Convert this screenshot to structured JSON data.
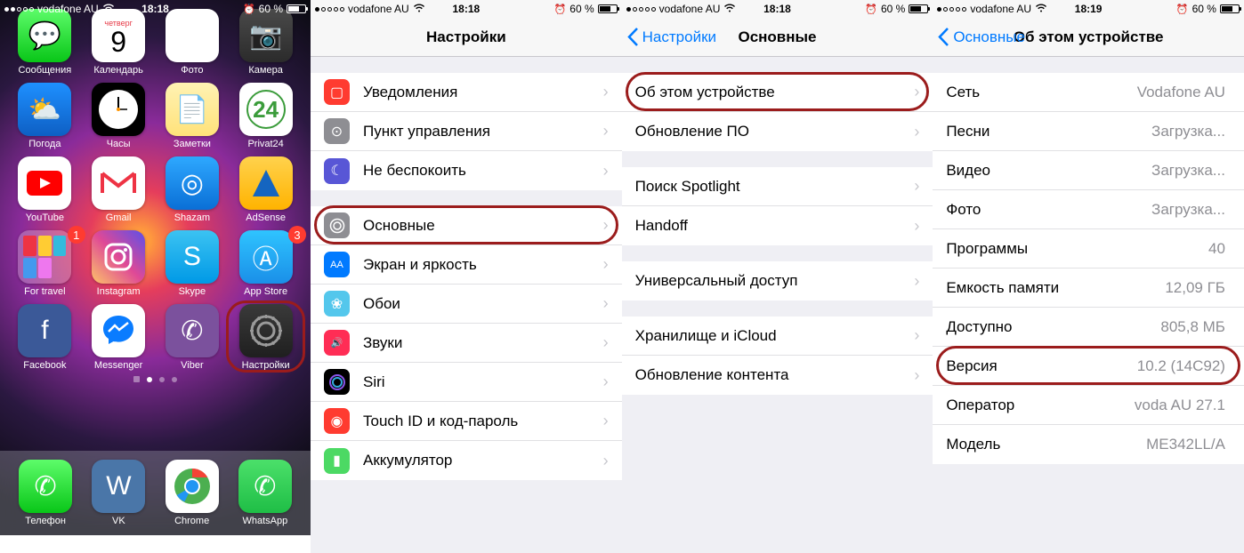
{
  "status": {
    "carrier": "vodafone AU",
    "battery": "60 %",
    "alarm": "⏰"
  },
  "times": [
    "18:18",
    "18:18",
    "18:18",
    "18:19"
  ],
  "home": {
    "apps": [
      {
        "label": "Сообщения",
        "bg": "linear-gradient(#5dfc6a,#09c618)",
        "g": "💬"
      },
      {
        "label": "Календарь",
        "bg": "#fff",
        "day": "четверг",
        "num": "9"
      },
      {
        "label": "Фото",
        "bg": "#fff",
        "g": "❀"
      },
      {
        "label": "Камера",
        "bg": "linear-gradient(#4a4a4a,#2b2b2b)",
        "g": "📷"
      },
      {
        "label": "Погода",
        "bg": "linear-gradient(#1e90ff,#0e5fc4)",
        "g": "⛅"
      },
      {
        "label": "Часы",
        "bg": "#000",
        "clock": true
      },
      {
        "label": "Заметки",
        "bg": "linear-gradient(#fff2b3,#ffe27a)",
        "g": "📄"
      },
      {
        "label": "Privat24",
        "bg": "#fff",
        "g24": "24"
      },
      {
        "label": "YouTube",
        "bg": "#fff",
        "yt": true
      },
      {
        "label": "Gmail",
        "bg": "#fff",
        "gm": true
      },
      {
        "label": "Shazam",
        "bg": "linear-gradient(#2ea8ff,#0a6fd6)",
        "g": "◎"
      },
      {
        "label": "AdSense",
        "bg": "linear-gradient(#ffd24d,#ffb300)",
        "ad": true
      },
      {
        "label": "For travel",
        "folder": true,
        "badge": "1"
      },
      {
        "label": "Instagram",
        "bg": "linear-gradient(45deg,#fdc468,#df4996,#5b4fe9)",
        "ig": true
      },
      {
        "label": "Skype",
        "bg": "linear-gradient(#3cc3f2,#0099e6)",
        "g": "S"
      },
      {
        "label": "App Store",
        "bg": "linear-gradient(#2fc4ff,#1a8fe8)",
        "g": "Ⓐ",
        "badge": "3"
      },
      {
        "label": "Facebook",
        "bg": "#3b5998",
        "g": "f"
      },
      {
        "label": "Messenger",
        "bg": "#fff",
        "msgr": true
      },
      {
        "label": "Viber",
        "bg": "#7b519d",
        "g": "✆"
      },
      {
        "label": "Настройки",
        "bg": "linear-gradient(#3a3a3a,#1f1f1f)",
        "gear": true,
        "ring": true
      }
    ],
    "dock": [
      {
        "label": "Телефон",
        "bg": "linear-gradient(#5dfc6a,#09c618)",
        "g": "✆"
      },
      {
        "label": "VK",
        "bg": "#4a76a8",
        "g": "W"
      },
      {
        "label": "Chrome",
        "bg": "#fff",
        "chrome": true
      },
      {
        "label": "WhatsApp",
        "bg": "linear-gradient(#4be06a,#1fbe46)",
        "g": "✆"
      }
    ]
  },
  "settings": {
    "title": "Настройки",
    "g1": [
      {
        "label": "Уведомления",
        "bg": "#ff3b30",
        "g": "▢"
      },
      {
        "label": "Пункт управления",
        "bg": "#8e8e93",
        "g": "⊙"
      },
      {
        "label": "Не беспокоить",
        "bg": "#5856d6",
        "g": "☾"
      }
    ],
    "g2": [
      {
        "label": "Основные",
        "bg": "#8e8e93",
        "gear": true,
        "ring": true
      },
      {
        "label": "Экран и яркость",
        "bg": "#007aff",
        "g": "AA"
      },
      {
        "label": "Обои",
        "bg": "#54c7ec",
        "g": "❀"
      },
      {
        "label": "Звуки",
        "bg": "#ff2d55",
        "g": "🔊"
      },
      {
        "label": "Siri",
        "bg": "#000",
        "siri": true
      },
      {
        "label": "Touch ID и код-пароль",
        "bg": "#ff3b30",
        "g": "◉"
      },
      {
        "label": "Аккумулятор",
        "bg": "#4cd964",
        "g": "▮"
      }
    ]
  },
  "general": {
    "back": "Настройки",
    "title": "Основные",
    "g1": [
      {
        "label": "Об этом устройстве",
        "ring": true
      },
      {
        "label": "Обновление ПО"
      }
    ],
    "g2": [
      {
        "label": "Поиск Spotlight"
      },
      {
        "label": "Handoff"
      }
    ],
    "g3": [
      {
        "label": "Универсальный доступ"
      }
    ],
    "g4": [
      {
        "label": "Хранилище и iCloud"
      },
      {
        "label": "Обновление контента"
      }
    ]
  },
  "about": {
    "back": "Основные",
    "title": "Об этом устройстве",
    "rows": [
      {
        "label": "Сеть",
        "value": "Vodafone AU"
      },
      {
        "label": "Песни",
        "value": "Загрузка..."
      },
      {
        "label": "Видео",
        "value": "Загрузка..."
      },
      {
        "label": "Фото",
        "value": "Загрузка..."
      },
      {
        "label": "Программы",
        "value": "40"
      },
      {
        "label": "Емкость памяти",
        "value": "12,09 ГБ"
      },
      {
        "label": "Доступно",
        "value": "805,8 МБ"
      },
      {
        "label": "Версия",
        "value": "10.2 (14C92)",
        "ring": true
      },
      {
        "label": "Оператор",
        "value": "voda AU 27.1"
      },
      {
        "label": "Модель",
        "value": "ME342LL/A"
      }
    ]
  }
}
